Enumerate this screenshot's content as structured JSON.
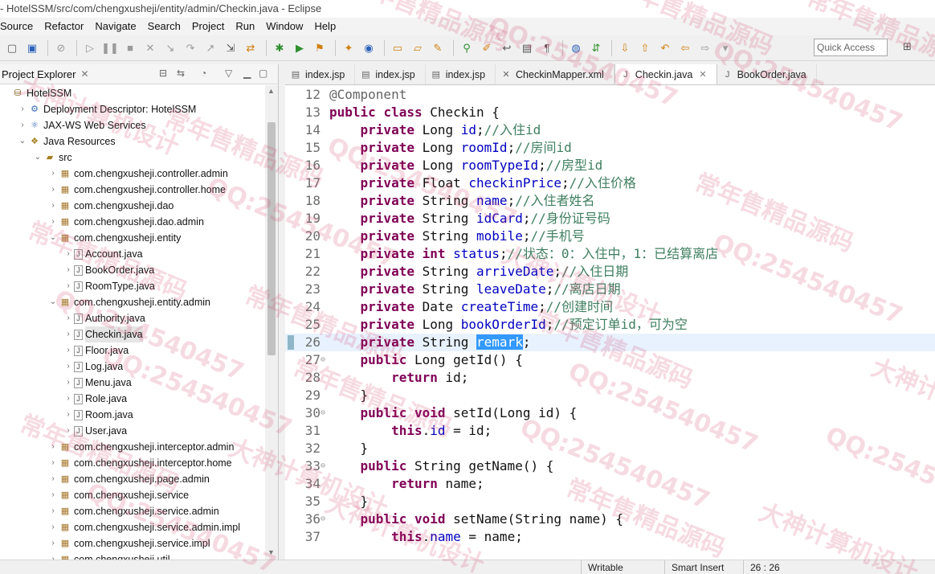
{
  "window": {
    "title": "- HotelSSM/src/com/chengxusheji/entity/admin/Checkin.java - Eclipse"
  },
  "menubar": [
    "Source",
    "Refactor",
    "Navigate",
    "Search",
    "Project",
    "Run",
    "Window",
    "Help"
  ],
  "toolbar": {
    "quick_access_placeholder": "Quick Access"
  },
  "explorer": {
    "title": "Project Explorer",
    "items": [
      {
        "label": "HotelSSM",
        "icon": "project-icon",
        "expanded": true
      },
      {
        "label": "Deployment Descriptor: HotelSSM",
        "icon": "deployment-icon"
      },
      {
        "label": "JAX-WS Web Services",
        "icon": "webservice-icon"
      },
      {
        "label": "Java Resources",
        "icon": "java-resources-icon",
        "expanded": true
      },
      {
        "label": "src",
        "icon": "source-folder-icon",
        "expanded": true
      },
      {
        "label": "com.chengxusheji.controller.admin",
        "icon": "package-icon"
      },
      {
        "label": "com.chengxusheji.controller.home",
        "icon": "package-icon"
      },
      {
        "label": "com.chengxusheji.dao",
        "icon": "package-icon"
      },
      {
        "label": "com.chengxusheji.dao.admin",
        "icon": "package-icon"
      },
      {
        "label": "com.chengxusheji.entity",
        "icon": "package-icon",
        "expanded": true
      },
      {
        "label": "Account.java",
        "icon": "java-file-icon"
      },
      {
        "label": "BookOrder.java",
        "icon": "java-file-icon"
      },
      {
        "label": "RoomType.java",
        "icon": "java-file-icon"
      },
      {
        "label": "com.chengxusheji.entity.admin",
        "icon": "package-icon",
        "expanded": true
      },
      {
        "label": "Authority.java",
        "icon": "java-file-icon"
      },
      {
        "label": "Checkin.java",
        "icon": "java-file-icon",
        "selected": true
      },
      {
        "label": "Floor.java",
        "icon": "java-file-icon"
      },
      {
        "label": "Log.java",
        "icon": "java-file-icon"
      },
      {
        "label": "Menu.java",
        "icon": "java-file-icon"
      },
      {
        "label": "Role.java",
        "icon": "java-file-icon"
      },
      {
        "label": "Room.java",
        "icon": "java-file-icon"
      },
      {
        "label": "User.java",
        "icon": "java-file-icon"
      },
      {
        "label": "com.chengxusheji.interceptor.admin",
        "icon": "package-icon"
      },
      {
        "label": "com.chengxusheji.interceptor.home",
        "icon": "package-icon"
      },
      {
        "label": "com.chengxusheji.page.admin",
        "icon": "package-icon"
      },
      {
        "label": "com.chengxusheji.service",
        "icon": "package-icon"
      },
      {
        "label": "com.chengxusheji.service.admin",
        "icon": "package-icon"
      },
      {
        "label": "com.chengxusheji.service.admin.impl",
        "icon": "package-icon"
      },
      {
        "label": "com.chengxusheji.service.impl",
        "icon": "package-icon"
      },
      {
        "label": "com.chengxusheji.util",
        "icon": "package-icon"
      }
    ]
  },
  "editor": {
    "tabs": [
      {
        "label": "index.jsp",
        "icon": "jsp-file-icon"
      },
      {
        "label": "index.jsp",
        "icon": "jsp-file-icon"
      },
      {
        "label": "index.jsp",
        "icon": "jsp-file-icon"
      },
      {
        "label": "CheckinMapper.xml",
        "icon": "xml-file-icon"
      },
      {
        "label": "Checkin.java",
        "icon": "java-file-icon",
        "active": true
      },
      {
        "label": "BookOrder.java",
        "icon": "java-file-icon"
      }
    ],
    "lines": [
      {
        "n": "12",
        "code": "@Component"
      },
      {
        "n": "13",
        "code": "public class Checkin {"
      },
      {
        "n": "14",
        "code": "    private Long id;//入住id"
      },
      {
        "n": "15",
        "code": "    private Long roomId;//房间id"
      },
      {
        "n": "16",
        "code": "    private Long roomTypeId;//房型id"
      },
      {
        "n": "17",
        "code": "    private Float checkinPrice;//入住价格"
      },
      {
        "n": "18",
        "code": "    private String name;//入住者姓名"
      },
      {
        "n": "19",
        "code": "    private String idCard;//身份证号码"
      },
      {
        "n": "20",
        "code": "    private String mobile;//手机号"
      },
      {
        "n": "21",
        "code": "    private int status;//状态：0：入住中，1：已结算离店"
      },
      {
        "n": "22",
        "code": "    private String arriveDate;//入住日期"
      },
      {
        "n": "23",
        "code": "    private String leaveDate;//离店日期"
      },
      {
        "n": "24",
        "code": "    private Date createTime;//创建时间"
      },
      {
        "n": "25",
        "code": "    private Long bookOrderId;//预定订单id，可为空"
      },
      {
        "n": "26",
        "code": "    private String remark;"
      },
      {
        "n": "27",
        "code": "    public Long getId() {"
      },
      {
        "n": "28",
        "code": "        return id;"
      },
      {
        "n": "29",
        "code": "    }"
      },
      {
        "n": "30",
        "code": "    public void setId(Long id) {"
      },
      {
        "n": "31",
        "code": "        this.id = id;"
      },
      {
        "n": "32",
        "code": "    }"
      },
      {
        "n": "33",
        "code": "    public String getName() {"
      },
      {
        "n": "34",
        "code": "        return name;"
      },
      {
        "n": "35",
        "code": "    }"
      },
      {
        "n": "36",
        "code": "    public void setName(String name) {"
      },
      {
        "n": "37",
        "code": "        this.name = name;"
      }
    ],
    "current_line": "26",
    "selected_word": "remark",
    "folding_lines": [
      "27",
      "30",
      "33",
      "36"
    ]
  },
  "statusbar": {
    "mode": "Writable",
    "insert": "Smart Insert",
    "position": "26 : 26"
  },
  "watermark": {
    "texts": [
      "常年售精品源码",
      "QQ:254540457",
      "大神计算机设计"
    ]
  },
  "colors": {
    "keyword": "#7f0055",
    "comment": "#3f7f5f",
    "field": "#0000c0",
    "selection": "#3399ff"
  }
}
